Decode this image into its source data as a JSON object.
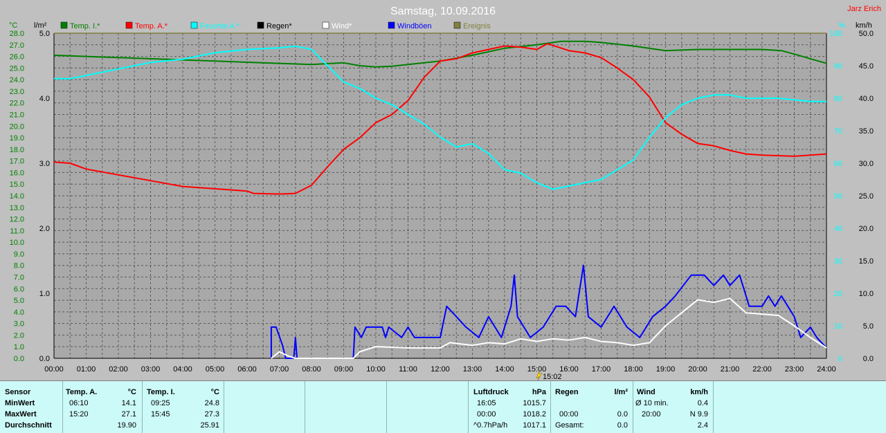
{
  "title": "Samstag, 10.09.2016",
  "author": "Jarz Erich",
  "left_units": [
    "°C",
    "l/m²"
  ],
  "right_units": [
    "%",
    "km/h"
  ],
  "legend": [
    {
      "name": "Temp. I.*",
      "color": "#008000"
    },
    {
      "name": "Temp. A.*",
      "color": "#ff0000"
    },
    {
      "name": "Feuchte A.*",
      "color": "#00ffff"
    },
    {
      "name": "Regen*",
      "color": "#000000"
    },
    {
      "name": "Wind*",
      "color": "#ffffff"
    },
    {
      "name": "Windböen",
      "color": "#0000ff"
    },
    {
      "name": "Ereignis",
      "color": "#808040"
    }
  ],
  "marker_label": "15:02",
  "chart_data": {
    "type": "line",
    "x_ticks": [
      "00:00",
      "01:00",
      "02:00",
      "03:00",
      "04:00",
      "05:00",
      "06:00",
      "07:00",
      "08:00",
      "09:00",
      "10:00",
      "11:00",
      "12:00",
      "13:00",
      "14:00",
      "15:00",
      "16:00",
      "17:00",
      "18:00",
      "19:00",
      "20:00",
      "21:00",
      "22:00",
      "23:00",
      "24:00"
    ],
    "axes": {
      "temp_c": {
        "range": [
          0,
          28
        ],
        "ticks": [
          "0.0",
          "1.0",
          "2.0",
          "3.0",
          "4.0",
          "5.0",
          "6.0",
          "7.0",
          "8.0",
          "9.0",
          "10.0",
          "11.0",
          "12.0",
          "13.0",
          "14.0",
          "15.0",
          "16.0",
          "17.0",
          "18.0",
          "19.0",
          "20.0",
          "21.0",
          "22.0",
          "23.0",
          "24.0",
          "25.0",
          "26.0",
          "27.0",
          "28.0"
        ]
      },
      "rain_lm2": {
        "range": [
          0,
          5
        ],
        "ticks": [
          "0.0",
          "1.0",
          "2.0",
          "3.0",
          "4.0",
          "5.0"
        ]
      },
      "humidity_pct": {
        "range": [
          0,
          100
        ],
        "ticks": [
          "0",
          "10",
          "20",
          "30",
          "40",
          "50",
          "60",
          "70",
          "80",
          "90",
          "100"
        ]
      },
      "wind_kmh": {
        "range": [
          0,
          50
        ],
        "ticks": [
          "0.0",
          "5.0",
          "10.0",
          "15.0",
          "20.0",
          "25.0",
          "30.0",
          "35.0",
          "40.0",
          "45.0",
          "50.0"
        ]
      }
    },
    "grid": true,
    "series": [
      {
        "name": "Temp. I.*",
        "axis": "temp_c",
        "color": "#008000",
        "points": [
          [
            0,
            26.1
          ],
          [
            1,
            26.0
          ],
          [
            2,
            25.9
          ],
          [
            3,
            25.8
          ],
          [
            4,
            25.7
          ],
          [
            5,
            25.6
          ],
          [
            6,
            25.5
          ],
          [
            7,
            25.4
          ],
          [
            8,
            25.3
          ],
          [
            9,
            25.45
          ],
          [
            9.5,
            25.2
          ],
          [
            10,
            25.1
          ],
          [
            10.5,
            25.15
          ],
          [
            11,
            25.3
          ],
          [
            12,
            25.6
          ],
          [
            13,
            26.1
          ],
          [
            14,
            26.7
          ],
          [
            15,
            27.0
          ],
          [
            15.75,
            27.3
          ],
          [
            16.5,
            27.3
          ],
          [
            17,
            27.2
          ],
          [
            18,
            26.9
          ],
          [
            19,
            26.5
          ],
          [
            20,
            26.6
          ],
          [
            21,
            26.6
          ],
          [
            22,
            26.6
          ],
          [
            22.6,
            26.5
          ],
          [
            23,
            26.2
          ],
          [
            23.5,
            25.8
          ],
          [
            24,
            25.4
          ]
        ]
      },
      {
        "name": "Temp. A.*",
        "axis": "temp_c",
        "color": "#ff0000",
        "points": [
          [
            0,
            16.9
          ],
          [
            0.5,
            16.8
          ],
          [
            1,
            16.3
          ],
          [
            2,
            15.8
          ],
          [
            3,
            15.3
          ],
          [
            4,
            14.8
          ],
          [
            5,
            14.6
          ],
          [
            6,
            14.4
          ],
          [
            6.2,
            14.2
          ],
          [
            7,
            14.15
          ],
          [
            7.5,
            14.2
          ],
          [
            8,
            14.9
          ],
          [
            8.5,
            16.5
          ],
          [
            9,
            18.0
          ],
          [
            9.5,
            19.0
          ],
          [
            10,
            20.3
          ],
          [
            10.5,
            21.0
          ],
          [
            11,
            22.2
          ],
          [
            11.5,
            24.2
          ],
          [
            12,
            25.6
          ],
          [
            12.5,
            25.8
          ],
          [
            13,
            26.3
          ],
          [
            13.5,
            26.6
          ],
          [
            14,
            26.9
          ],
          [
            14.5,
            26.8
          ],
          [
            15,
            26.6
          ],
          [
            15.33,
            27.1
          ],
          [
            16,
            26.5
          ],
          [
            16.5,
            26.3
          ],
          [
            17,
            25.9
          ],
          [
            17.5,
            25.0
          ],
          [
            18,
            24.0
          ],
          [
            18.5,
            22.5
          ],
          [
            19,
            20.3
          ],
          [
            19.5,
            19.3
          ],
          [
            20,
            18.5
          ],
          [
            20.5,
            18.3
          ],
          [
            21,
            17.9
          ],
          [
            21.5,
            17.6
          ],
          [
            22,
            17.5
          ],
          [
            23,
            17.4
          ],
          [
            23.5,
            17.5
          ],
          [
            24,
            17.6
          ]
        ]
      },
      {
        "name": "Feuchte A.*",
        "axis": "humidity_pct",
        "color": "#00ffff",
        "points": [
          [
            0,
            86
          ],
          [
            0.5,
            86
          ],
          [
            1,
            87
          ],
          [
            2,
            89
          ],
          [
            3,
            91
          ],
          [
            4,
            92
          ],
          [
            5,
            94
          ],
          [
            6,
            95
          ],
          [
            7,
            95.5
          ],
          [
            7.5,
            96
          ],
          [
            8,
            95
          ],
          [
            8.5,
            90
          ],
          [
            9,
            85
          ],
          [
            9.5,
            83
          ],
          [
            10,
            80
          ],
          [
            10.5,
            78
          ],
          [
            11,
            75
          ],
          [
            11.5,
            72
          ],
          [
            12,
            68
          ],
          [
            12.5,
            65
          ],
          [
            13,
            66
          ],
          [
            13.5,
            63
          ],
          [
            14,
            58
          ],
          [
            14.5,
            57
          ],
          [
            15,
            54
          ],
          [
            15.5,
            52
          ],
          [
            16,
            53
          ],
          [
            16.5,
            54
          ],
          [
            17,
            55
          ],
          [
            17.5,
            58
          ],
          [
            18,
            61
          ],
          [
            18.5,
            68
          ],
          [
            19,
            74
          ],
          [
            19.5,
            78
          ],
          [
            20,
            80
          ],
          [
            20.5,
            81
          ],
          [
            21,
            81
          ],
          [
            21.5,
            80
          ],
          [
            22,
            80
          ],
          [
            22.5,
            80
          ],
          [
            23,
            79.5
          ],
          [
            23.5,
            79
          ],
          [
            24,
            79
          ]
        ]
      },
      {
        "name": "Windböen",
        "axis": "wind_kmh",
        "color": "#0000ff",
        "points": [
          [
            6.75,
            0
          ],
          [
            6.75,
            4.8
          ],
          [
            6.9,
            4.8
          ],
          [
            7.1,
            2.0
          ],
          [
            7.2,
            0
          ],
          [
            7.45,
            0
          ],
          [
            7.5,
            3.2
          ],
          [
            7.55,
            0
          ],
          [
            9.3,
            0
          ],
          [
            9.35,
            4.8
          ],
          [
            9.55,
            3.2
          ],
          [
            9.7,
            4.8
          ],
          [
            10.2,
            4.8
          ],
          [
            10.3,
            3.2
          ],
          [
            10.4,
            4.8
          ],
          [
            10.8,
            3.2
          ],
          [
            11.0,
            4.8
          ],
          [
            11.2,
            3.2
          ],
          [
            12.0,
            3.2
          ],
          [
            12.2,
            8.0
          ],
          [
            12.5,
            6.4
          ],
          [
            12.8,
            4.8
          ],
          [
            13.2,
            3.2
          ],
          [
            13.5,
            6.4
          ],
          [
            13.9,
            3.2
          ],
          [
            14.2,
            8.0
          ],
          [
            14.3,
            12.8
          ],
          [
            14.4,
            6.4
          ],
          [
            14.8,
            3.2
          ],
          [
            15.2,
            4.8
          ],
          [
            15.6,
            8.0
          ],
          [
            15.9,
            8.0
          ],
          [
            16.2,
            6.4
          ],
          [
            16.45,
            14.3
          ],
          [
            16.6,
            6.4
          ],
          [
            17.0,
            4.8
          ],
          [
            17.4,
            8.0
          ],
          [
            17.8,
            4.8
          ],
          [
            18.2,
            3.2
          ],
          [
            18.6,
            6.4
          ],
          [
            19.0,
            8.0
          ],
          [
            19.3,
            9.6
          ],
          [
            19.8,
            12.8
          ],
          [
            20.2,
            12.8
          ],
          [
            20.5,
            11.2
          ],
          [
            20.8,
            12.8
          ],
          [
            21.0,
            11.2
          ],
          [
            21.3,
            12.8
          ],
          [
            21.6,
            8.0
          ],
          [
            22.0,
            8.0
          ],
          [
            22.2,
            9.6
          ],
          [
            22.4,
            8.0
          ],
          [
            22.6,
            9.6
          ],
          [
            22.8,
            8.0
          ],
          [
            23.0,
            6.4
          ],
          [
            23.2,
            3.2
          ],
          [
            23.5,
            4.8
          ],
          [
            23.7,
            3.2
          ],
          [
            24,
            1.6
          ]
        ]
      },
      {
        "name": "Wind*",
        "axis": "wind_kmh",
        "color": "#ffffff",
        "points": [
          [
            6.75,
            0
          ],
          [
            7.0,
            1.0
          ],
          [
            7.3,
            0.3
          ],
          [
            7.5,
            0
          ],
          [
            9.3,
            0
          ],
          [
            9.5,
            1.0
          ],
          [
            10,
            1.8
          ],
          [
            11,
            1.6
          ],
          [
            12,
            1.6
          ],
          [
            12.3,
            2.4
          ],
          [
            13,
            2.0
          ],
          [
            13.5,
            2.4
          ],
          [
            14,
            2.2
          ],
          [
            14.5,
            3.0
          ],
          [
            15,
            2.6
          ],
          [
            15.5,
            3.0
          ],
          [
            16,
            2.8
          ],
          [
            16.5,
            3.2
          ],
          [
            17,
            2.6
          ],
          [
            17.5,
            2.4
          ],
          [
            18,
            2.0
          ],
          [
            18.5,
            2.4
          ],
          [
            19,
            5.0
          ],
          [
            19.5,
            7.0
          ],
          [
            20,
            9.0
          ],
          [
            20.5,
            8.6
          ],
          [
            21,
            9.2
          ],
          [
            21.5,
            7.0
          ],
          [
            22,
            6.8
          ],
          [
            22.5,
            6.6
          ],
          [
            23,
            5.0
          ],
          [
            23.5,
            3.2
          ],
          [
            24,
            1.6
          ]
        ]
      }
    ]
  },
  "stats": {
    "sensor": {
      "header": "Sensor",
      "rows": [
        "MinWert",
        "MaxWert",
        "Durchschnitt"
      ]
    },
    "temp_a": {
      "header": "Temp. A.",
      "unit": "°C",
      "min_time": "06:10",
      "min_val": "14.1",
      "max_time": "15:20",
      "max_val": "27.1",
      "avg": "19.90"
    },
    "temp_i": {
      "header": "Temp. I.",
      "unit": "°C",
      "min_time": "09:25",
      "min_val": "24.8",
      "max_time": "15:45",
      "max_val": "27.3",
      "avg": "25.91"
    },
    "pressure": {
      "header": "Luftdruck",
      "unit": "hPa",
      "r1_label": "16:05",
      "r1_val": "1015.7",
      "r2_label": "00:00",
      "r2_val": "1018.2",
      "r3_label": "^0.7hPa/h",
      "r3_val": "1017.1"
    },
    "rain": {
      "header": "Regen",
      "unit": "l/m²",
      "r2_label": "00:00",
      "r2_val": "0.0",
      "r3_label": "Gesamt:",
      "r3_val": "0.0"
    },
    "wind": {
      "header": "Wind",
      "unit": "km/h",
      "r1_label": "Ø 10 min.",
      "r1_val": "0.4",
      "r2_label": "20:00",
      "r2_val": "N 9.9",
      "r3_val": "2.4"
    }
  }
}
